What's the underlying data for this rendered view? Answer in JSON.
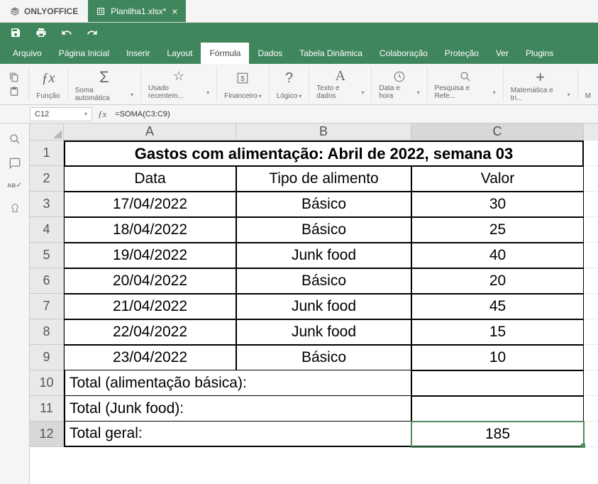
{
  "app_name": "ONLYOFFICE",
  "doc_tab": "Planilha1.xlsx*",
  "menu": {
    "arquivo": "Arquivo",
    "pagina_inicial": "Página Inicial",
    "inserir": "Inserir",
    "layout": "Layout",
    "formula": "Fórmula",
    "dados": "Dados",
    "tabela_dinamica": "Tabela Dinâmica",
    "colaboracao": "Colaboração",
    "protecao": "Proteção",
    "ver": "Ver",
    "plugins": "Plugins"
  },
  "ribbon": {
    "funcao": "Função",
    "soma": "Soma automática",
    "recente": "Usado recentem...",
    "financeiro": "Financeiro",
    "logico": "Lógico",
    "texto": "Texto e dados",
    "data": "Data e hora",
    "pesquisa": "Pesquisa e Refe...",
    "matematica": "Matemática e tri...",
    "more": "M"
  },
  "name_box": "C12",
  "formula": "=SOMA(C3:C9)",
  "cols": {
    "A": "A",
    "B": "B",
    "C": "C"
  },
  "sheet": {
    "title": "Gastos com alimentação: Abril de 2022, semana 03",
    "headers": {
      "data": "Data",
      "tipo": "Tipo de alimento",
      "valor": "Valor"
    },
    "rows": [
      {
        "data": "17/04/2022",
        "tipo": "Básico",
        "valor": "30"
      },
      {
        "data": "18/04/2022",
        "tipo": "Básico",
        "valor": "25"
      },
      {
        "data": "19/04/2022",
        "tipo": "Junk food",
        "valor": "40"
      },
      {
        "data": "20/04/2022",
        "tipo": "Básico",
        "valor": "20"
      },
      {
        "data": "21/04/2022",
        "tipo": "Junk food",
        "valor": "45"
      },
      {
        "data": "22/04/2022",
        "tipo": "Junk food",
        "valor": "15"
      },
      {
        "data": "23/04/2022",
        "tipo": "Básico",
        "valor": "10"
      }
    ],
    "total_basica": "Total (alimentação básica):",
    "total_junk": "Total (Junk food):",
    "total_geral": "Total geral:",
    "total_geral_val": "185"
  }
}
